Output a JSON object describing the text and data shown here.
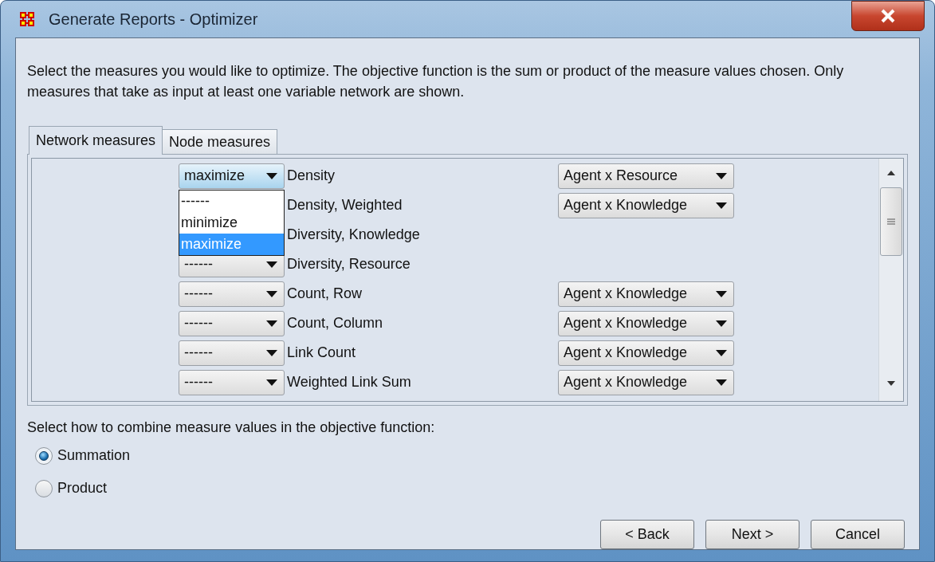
{
  "window": {
    "title": "Generate Reports - Optimizer"
  },
  "description": "Select the measures you would like to optimize. The objective function is the sum or product of the measure values chosen. Only measures that take as input at least one variable network are shown.",
  "tabs": [
    {
      "label": "Network measures",
      "selected": true
    },
    {
      "label": "Node measures",
      "selected": false
    }
  ],
  "measures": [
    {
      "objective": "maximize",
      "measure": "Density",
      "network": "Agent x Resource",
      "expanded": true,
      "options": [
        {
          "label": "------",
          "selected": false
        },
        {
          "label": "minimize",
          "selected": false
        },
        {
          "label": "maximize",
          "selected": true
        }
      ]
    },
    {
      "measure": "Density, Weighted",
      "network": "Agent x Knowledge"
    },
    {
      "measure": "Diversity, Knowledge"
    },
    {
      "objective": "------",
      "measure": "Diversity, Resource"
    },
    {
      "objective": "------",
      "measure": "Count, Row",
      "network": "Agent x Knowledge"
    },
    {
      "objective": "------",
      "measure": "Count, Column",
      "network": "Agent x Knowledge"
    },
    {
      "objective": "------",
      "measure": "Link Count",
      "network": "Agent x Knowledge"
    },
    {
      "objective": "------",
      "measure": "Weighted Link Sum",
      "network": "Agent x Knowledge"
    }
  ],
  "combine_label": "Select how to combine measure values in the objective function:",
  "combine_options": [
    {
      "label": "Summation",
      "selected": true
    },
    {
      "label": "Product",
      "selected": false
    }
  ],
  "buttons": [
    {
      "label": "< Back"
    },
    {
      "label": "Next >"
    },
    {
      "label": "Cancel"
    }
  ]
}
